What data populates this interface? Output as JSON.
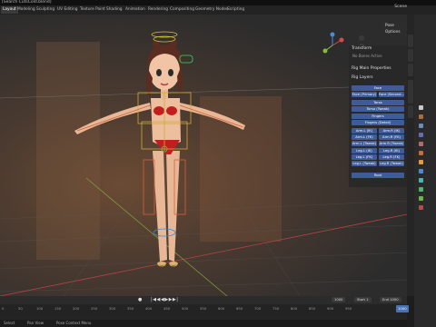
{
  "window": {
    "title": "[Search CutsCold.blend]"
  },
  "workspace_tabs": [
    "Layout",
    "Modeling",
    "Sculpting",
    "UV Editing",
    "Texture Paint",
    "Shading",
    "Animation",
    "Rendering",
    "Compositing",
    "Geometry Nodes",
    "Scripting"
  ],
  "active_tab": "Layout",
  "scene": {
    "label": "Scene"
  },
  "viewport": {
    "pose_options": "Pose Options"
  },
  "npanel": {
    "transform": "Transform",
    "no_bones": "No Bones Active",
    "rig_main": "Rig Main Properties",
    "rig_layers": "Rig Layers",
    "buttons": {
      "face": "Face",
      "face_primary": "Face (Primary)",
      "face_secondary": "Face (Second...",
      "torso": "Torso",
      "torso_tweak": "Torso (Tweak)",
      "fingers": "Fingers",
      "fingers_detail": "Fingers (Detail)",
      "arm_l_ik": "Arm.L (IK)",
      "arm_r_ik": "Arm.R (IK)",
      "arm_l_fk": "Arm.L (FK)",
      "arm_r_fk": "Arm.R (FK)",
      "arm_l_tweak": "Arm.L (Tweak)",
      "arm_r_tweak": "Arm.R (Tweak)",
      "leg_l_ik": "Leg.L (IK)",
      "leg_r_ik": "Leg.R (IK)",
      "leg_l_fk": "Leg.L (FK)",
      "leg_r_fk": "Leg.R (FK)",
      "leg_l_tweak": "Leg.L (Tweak)",
      "leg_r_tweak": "Leg.R (Tweak)",
      "root": "Root"
    }
  },
  "side_tabs": [
    "Item",
    "Tool",
    "View",
    "Animation",
    "Edit"
  ],
  "timeline": {
    "current_frame": "1000",
    "start_label": "Start",
    "start_value": "1",
    "end_label": "End",
    "end_value": "1000",
    "ticks": [
      "0",
      "50",
      "100",
      "150",
      "200",
      "250",
      "300",
      "350",
      "400",
      "450",
      "500",
      "550",
      "600",
      "650",
      "700",
      "750",
      "800",
      "850",
      "900",
      "950",
      "1000"
    ],
    "playhead": "1000"
  },
  "status": {
    "select": "Select",
    "pan": "Pan View",
    "menu": "Pose Context Menu"
  },
  "colors": {
    "accent": "#4772b3",
    "button": "#3f5c9a",
    "active_frame": "#4772b3"
  }
}
